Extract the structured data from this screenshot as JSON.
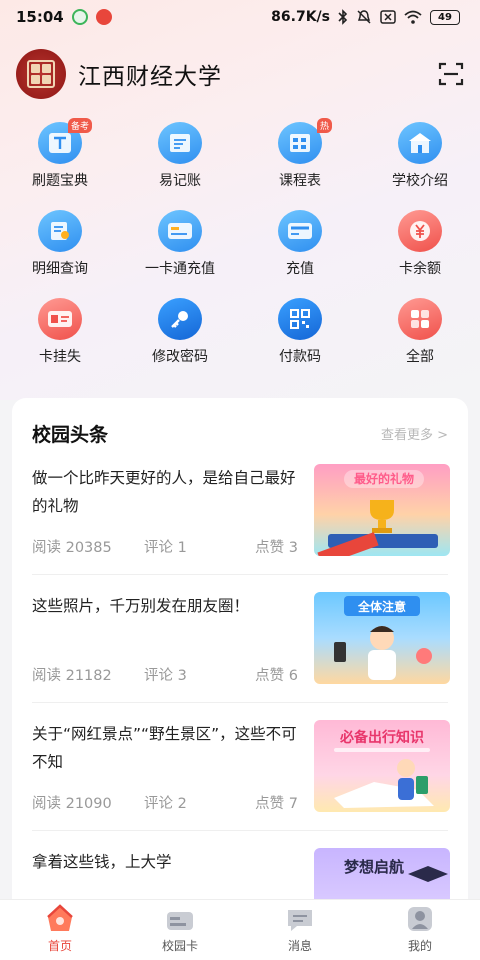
{
  "status": {
    "time": "15:04",
    "speed": "86.7K/s",
    "battery": "49"
  },
  "header": {
    "title": "江西财经大学"
  },
  "services": [
    {
      "label": "刷题宝典",
      "badge": "备考",
      "icon": "book-icon",
      "color": "blue"
    },
    {
      "label": "易记账",
      "badge": "",
      "icon": "notebook-icon",
      "color": "blue"
    },
    {
      "label": "课程表",
      "badge": "热",
      "icon": "timetable-icon",
      "color": "blue"
    },
    {
      "label": "学校介绍",
      "badge": "",
      "icon": "school-icon",
      "color": "blue"
    },
    {
      "label": "明细查询",
      "badge": "",
      "icon": "detail-query-icon",
      "color": "blue"
    },
    {
      "label": "一卡通充值",
      "badge": "",
      "icon": "card-recharge-icon",
      "color": "blue"
    },
    {
      "label": "充值",
      "badge": "",
      "icon": "recharge-icon",
      "color": "blue"
    },
    {
      "label": "卡余额",
      "badge": "",
      "icon": "balance-icon",
      "color": "red"
    },
    {
      "label": "卡挂失",
      "badge": "",
      "icon": "card-lost-icon",
      "color": "red"
    },
    {
      "label": "修改密码",
      "badge": "",
      "icon": "key-icon",
      "color": "blue"
    },
    {
      "label": "付款码",
      "badge": "",
      "icon": "qr-code-icon",
      "color": "blue"
    },
    {
      "label": "全部",
      "badge": "",
      "icon": "all-apps-icon",
      "color": "red"
    }
  ],
  "feed": {
    "title": "校园头条",
    "more": "查看更多 >",
    "items": [
      {
        "title": "做一个比昨天更好的人，是给自己最好的礼物",
        "reads": "阅读 20385",
        "comments": "评论 1",
        "likes": "点赞 3",
        "thumb_text": "最好的礼物"
      },
      {
        "title": "这些照片，千万别发在朋友圈！",
        "reads": "阅读 21182",
        "comments": "评论 3",
        "likes": "点赞 6",
        "thumb_text": "全体注意"
      },
      {
        "title": "关于“网红景点”“野生景区”，这些不可不知",
        "reads": "阅读 21090",
        "comments": "评论 2",
        "likes": "点赞 7",
        "thumb_text": "必备出行知识"
      },
      {
        "title": "拿着这些钱，上大学",
        "reads": "",
        "comments": "",
        "likes": "",
        "thumb_text": "梦想启航"
      }
    ]
  },
  "tabs": [
    {
      "label": "首页",
      "active": true
    },
    {
      "label": "校园卡",
      "active": false
    },
    {
      "label": "消息",
      "active": false
    },
    {
      "label": "我的",
      "active": false
    }
  ],
  "colors": {
    "accent": "#e8463b",
    "icon_blue": "#2f8ff0",
    "icon_red": "#f0514b"
  }
}
